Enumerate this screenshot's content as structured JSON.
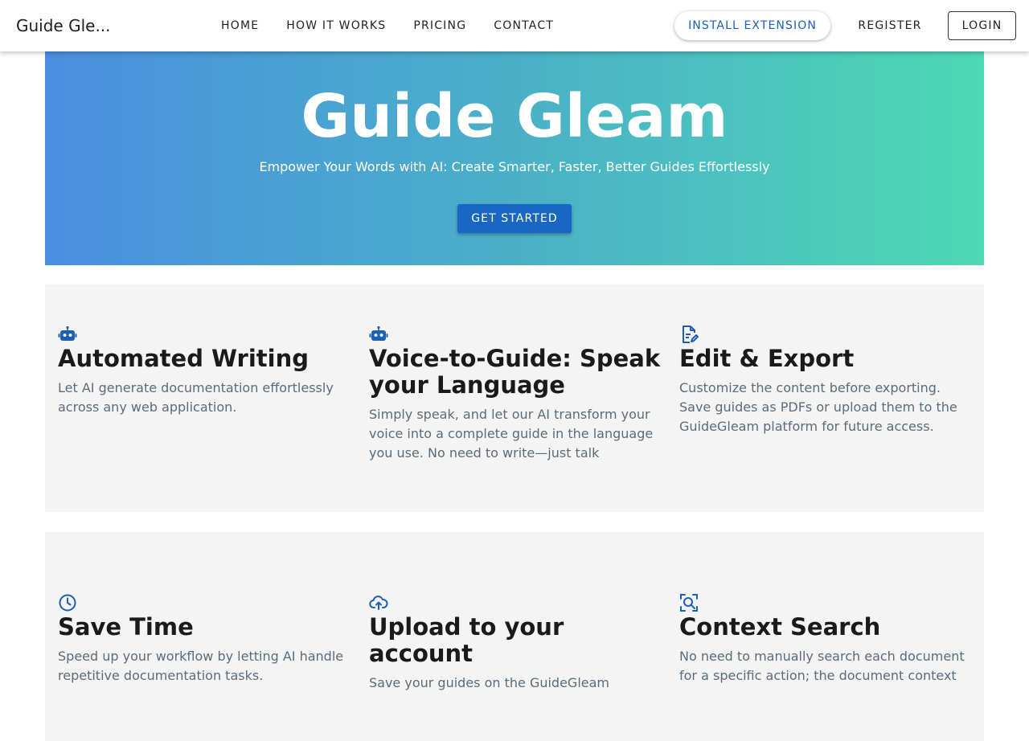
{
  "nav": {
    "brand": "Guide Gle...",
    "links": [
      "HOME",
      "HOW IT WORKS",
      "PRICING",
      "CONTACT"
    ],
    "install_label": "INSTALL EXTENSION",
    "register_label": "REGISTER",
    "login_label": "LOGIN"
  },
  "hero": {
    "title": "Guide Gleam",
    "subtitle": "Empower Your Words with AI: Create Smarter, Faster, Better Guides Effortlessly",
    "cta_label": "GET STARTED"
  },
  "features": [
    {
      "icon": "robot-icon",
      "title": "Automated Writing",
      "desc": "Let AI generate documentation effortlessly across any web application."
    },
    {
      "icon": "robot-icon",
      "title": "Voice-to-Guide: Speak your Language",
      "desc": "Simply speak, and let our AI transform your voice into a complete guide in the language you use. No need to write—just talk"
    },
    {
      "icon": "edit-document-icon",
      "title": "Edit & Export",
      "desc": "Customize the content before exporting. Save guides as PDFs or upload them to the GuideGleam platform for future access."
    },
    {
      "icon": "clock-icon",
      "title": "Save Time",
      "desc": "Speed up your workflow by letting AI handle repetitive documentation tasks."
    },
    {
      "icon": "cloud-upload-icon",
      "title": "Upload to your account",
      "desc": "Save your guides on the GuideGleam"
    },
    {
      "icon": "search-document-icon",
      "title": "Context Search",
      "desc": "No need to manually search each document for a specific action; the document context"
    }
  ],
  "colors": {
    "accent": "#1966c4",
    "icon": "#1b5fb8",
    "hero_gradient_start": "#4a8fe0",
    "hero_gradient_end": "#4fd8b4"
  }
}
